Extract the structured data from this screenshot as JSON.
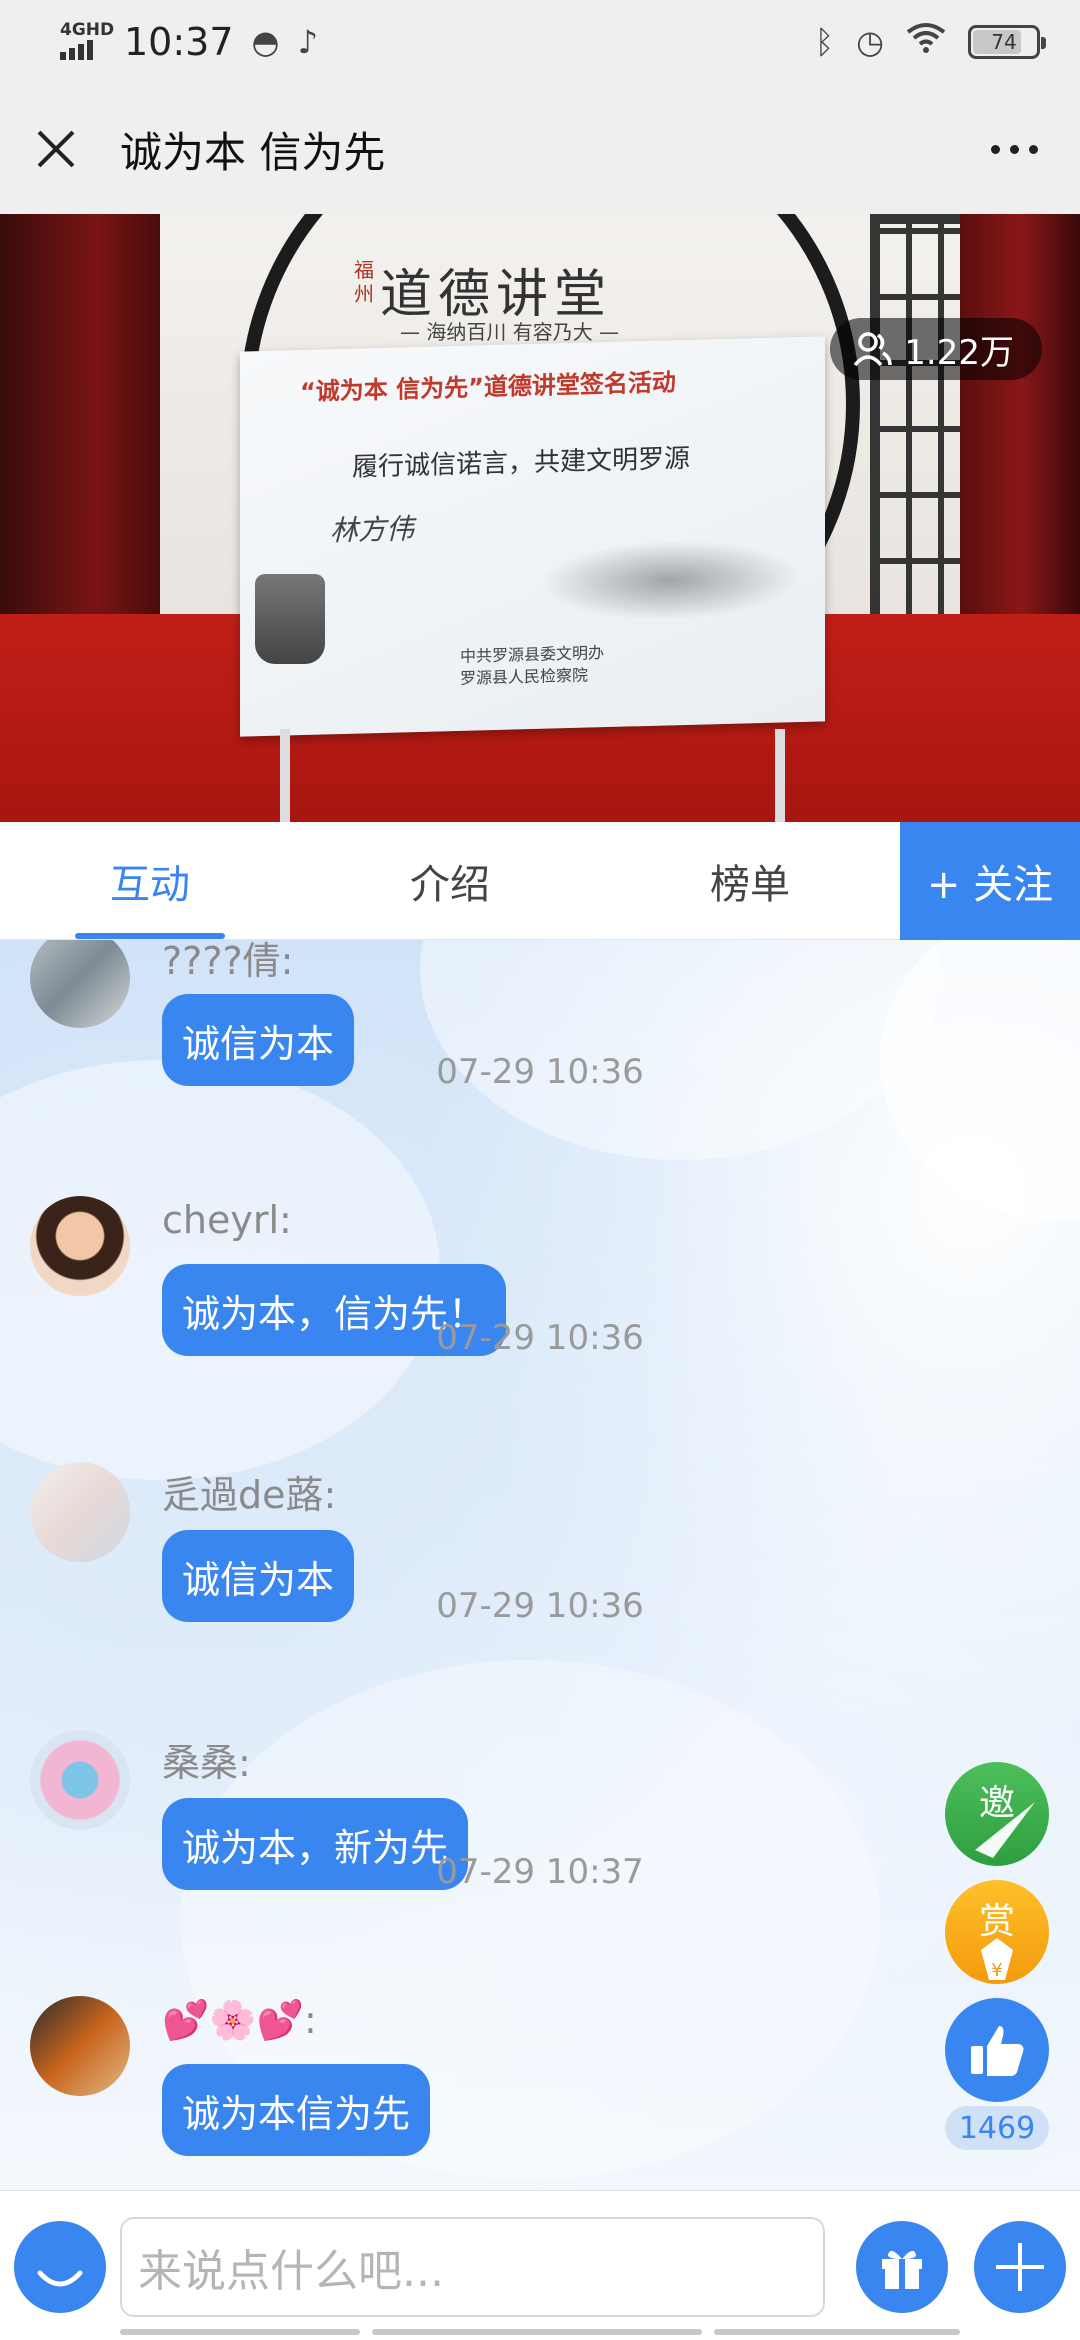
{
  "status_bar": {
    "network": "4GHD",
    "time": "10:37",
    "battery": "74",
    "icons": [
      "signal-icon",
      "qq-icon",
      "tiktok-icon",
      "bluetooth-icon",
      "alarm-icon",
      "wifi-icon",
      "battery-icon"
    ]
  },
  "header": {
    "title": "诚为本 信为先",
    "close_icon": "close-icon",
    "more_icon": "more-icon"
  },
  "video": {
    "viewer_count": "1.22万",
    "banner_small": "福州",
    "banner_title": "道德讲堂",
    "banner_sub": "— 海纳百川  有容乃大 —",
    "board_heading": "“诚为本 信为先”道德讲堂签名活动",
    "board_line": "履行诚信诺言，共建文明罗源",
    "board_signature": "林方伟",
    "board_footer_1": "中共罗源县委文明办",
    "board_footer_2": "罗源县人民检察院"
  },
  "tabs": [
    {
      "label": "互动",
      "active": true
    },
    {
      "label": "介绍",
      "active": false
    },
    {
      "label": "榜单",
      "active": false
    }
  ],
  "follow_label": "+ 关注",
  "messages": [
    {
      "user": "????倩:",
      "text": "诚信为本",
      "time": "07-29 10:36"
    },
    {
      "user": "cheyrl:",
      "text": "诚为本，信为先！",
      "time": "07-29 10:36"
    },
    {
      "user": "辵過de蕗:",
      "text": "诚信为本",
      "time": "07-29 10:36"
    },
    {
      "user": "桑桑:",
      "text": "诚为本，新为先",
      "time": "07-29 10:37"
    },
    {
      "user": "💕🌸💕:",
      "text": "诚为本信为先",
      "time": ""
    }
  ],
  "actions": {
    "invite_label": "邀",
    "reward_label": "赏",
    "like_count": "1469"
  },
  "input": {
    "placeholder": "来说点什么吧..."
  },
  "colors": {
    "accent": "#3a86f0",
    "invite": "#3fb24d",
    "reward": "#f5a815"
  }
}
